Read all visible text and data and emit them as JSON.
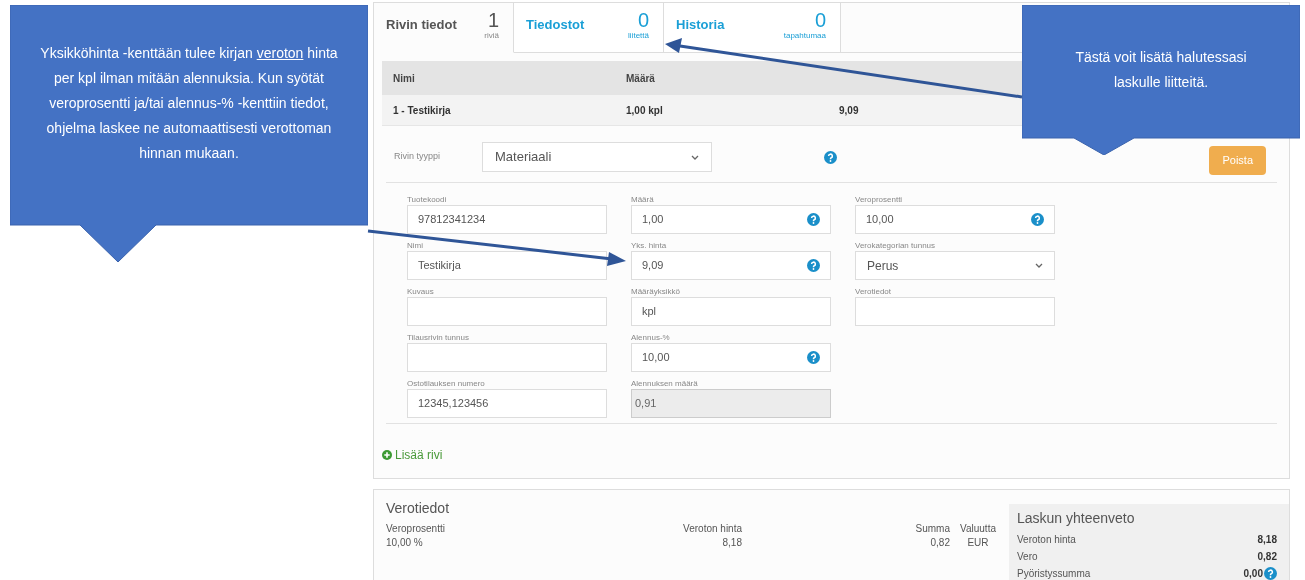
{
  "tabs": [
    {
      "label": "Rivin tiedot",
      "count": "1",
      "unit": "riviä",
      "selected": true
    },
    {
      "label": "Tiedostot",
      "count": "0",
      "unit": "liitettä",
      "selected": false
    },
    {
      "label": "Historia",
      "count": "0",
      "unit": "tapahtumaa",
      "selected": false
    }
  ],
  "table": {
    "columns": [
      "Nimi",
      "Määrä"
    ],
    "rows": [
      {
        "cells": [
          "1 - Testikirja",
          "1,00 kpl",
          "9,09"
        ]
      }
    ]
  },
  "row_editor": {
    "type_label": "Rivin tyyppi",
    "type_value": "Materiaali",
    "type_help": true,
    "delete_button": "Poista",
    "field_columns": [
      [
        {
          "label": "Tuotekoodi",
          "value": "97812341234",
          "kind": "input",
          "help": false
        },
        {
          "label": "Nimi",
          "value": "Testikirja",
          "kind": "input",
          "help": false
        },
        {
          "label": "Kuvaus",
          "kind": "input",
          "help": false
        },
        {
          "label": "Tilausrivin tunnus",
          "kind": "input",
          "help": false
        },
        {
          "label": "Ostotilauksen numero",
          "value": "12345,123456",
          "kind": "input",
          "help": false
        }
      ],
      [
        {
          "label": "Määrä",
          "value": "1,00",
          "kind": "input",
          "help": true
        },
        {
          "label": "Yks. hinta",
          "value": "9,09",
          "kind": "input",
          "help": true
        },
        {
          "label": "Määräyksikkö",
          "value": "kpl",
          "kind": "input",
          "help": false
        },
        {
          "label": "Alennus-%",
          "value": "10,00",
          "kind": "input",
          "help": true
        },
        {
          "label": "Alennuksen määrä",
          "value": "0,91",
          "kind": "readonly",
          "help": false
        }
      ],
      [
        {
          "label": "Veroprosentti",
          "value": "10,00",
          "kind": "input",
          "help": true
        },
        {
          "label": "Verokategorian tunnus",
          "value": "Perus",
          "kind": "select",
          "help": false
        },
        {
          "label": "Verotiedot",
          "kind": "input",
          "help": false
        }
      ]
    ],
    "add_row": "Lisää rivi"
  },
  "tax_panel": {
    "title": "Verotiedot",
    "columns": [
      {
        "label": "Veroprosentti",
        "value": "10,00 %"
      },
      {
        "label": "Veroton hinta",
        "value": "8,18"
      },
      {
        "label": "Summa",
        "value": "0,82"
      },
      {
        "label": "Valuutta",
        "value": "EUR"
      }
    ]
  },
  "summary": {
    "title": "Laskun yhteenveto",
    "rows": [
      {
        "label": "Veroton hinta",
        "value": "8,18",
        "help": false
      },
      {
        "label": "Vero",
        "value": "0,82",
        "help": false
      },
      {
        "label": "Pyöristyssumma",
        "value": "0,00",
        "help": true
      }
    ]
  },
  "callouts": [
    {
      "before": "Yksikköhinta -kenttään tulee kirjan",
      "underlined": "veroton",
      "after": " hinta per kpl ilman mitään alennuksia. Kun syötät veroprosentti ja/tai alennus-% -kenttiin tiedot, ohjelma laskee ne automaattisesti verottoman hinnan mukaan."
    },
    {
      "before": "Tästä voit lisätä halutessasi laskulle liitteitä."
    }
  ]
}
